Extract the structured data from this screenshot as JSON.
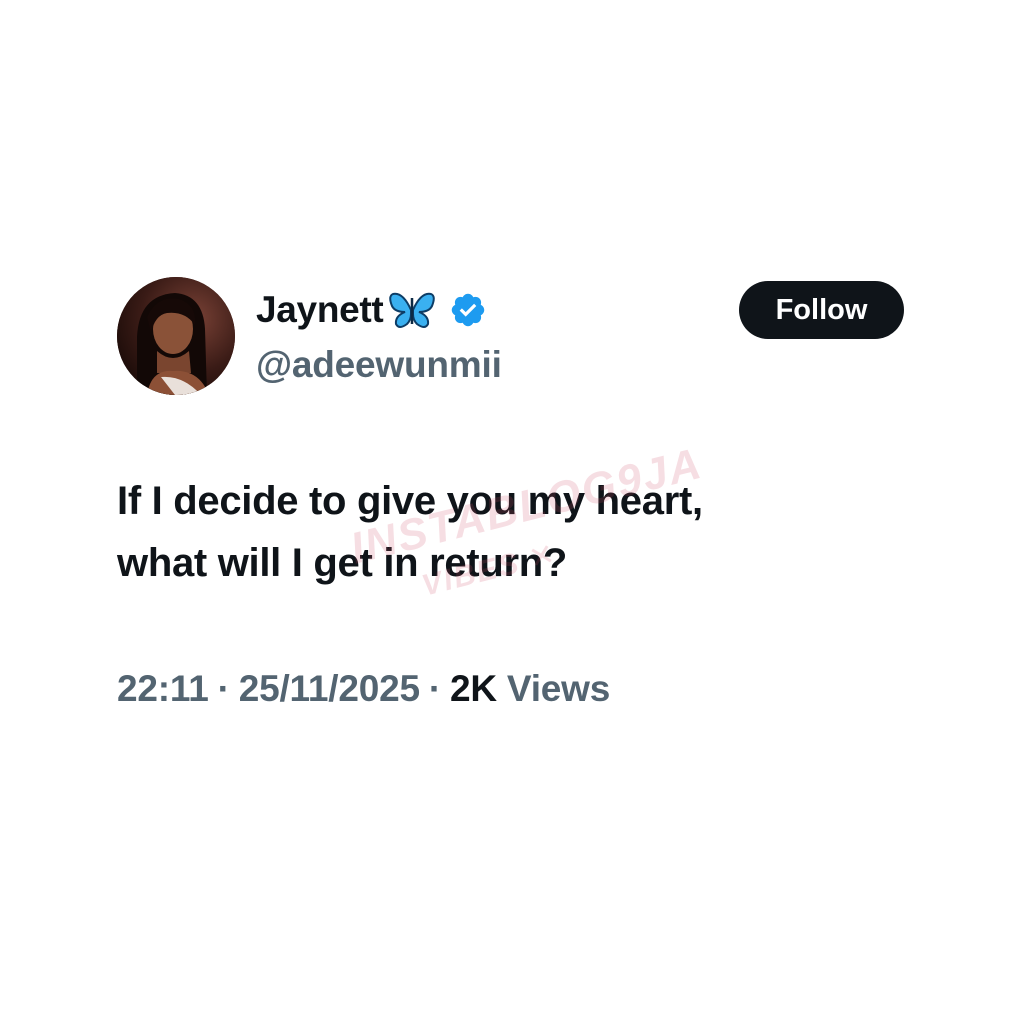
{
  "author": {
    "display_name": "Jaynett",
    "name_emoji_icon": "blue-butterfly-icon",
    "verified_icon": "verified-badge-icon",
    "verified_color": "#1d9bf0",
    "handle": "@adeewunmii",
    "avatar_icon": "profile-photo-avatar"
  },
  "follow_button": {
    "label": "Follow",
    "background": "#0f1419",
    "text_color": "#ffffff"
  },
  "tweet": {
    "text_line_1": "If I decide to give you my heart,",
    "text_line_2": "what will I get in return?"
  },
  "meta": {
    "time": "22:11",
    "date": "25/11/2025",
    "separator": "·",
    "views_count": "2K",
    "views_label": "Views"
  },
  "watermark": {
    "line_1": "INSTABLOG9JA",
    "line_2": "VIBES ✕"
  },
  "colors": {
    "text_primary": "#0f1419",
    "text_secondary": "#536471",
    "background": "#ffffff"
  }
}
